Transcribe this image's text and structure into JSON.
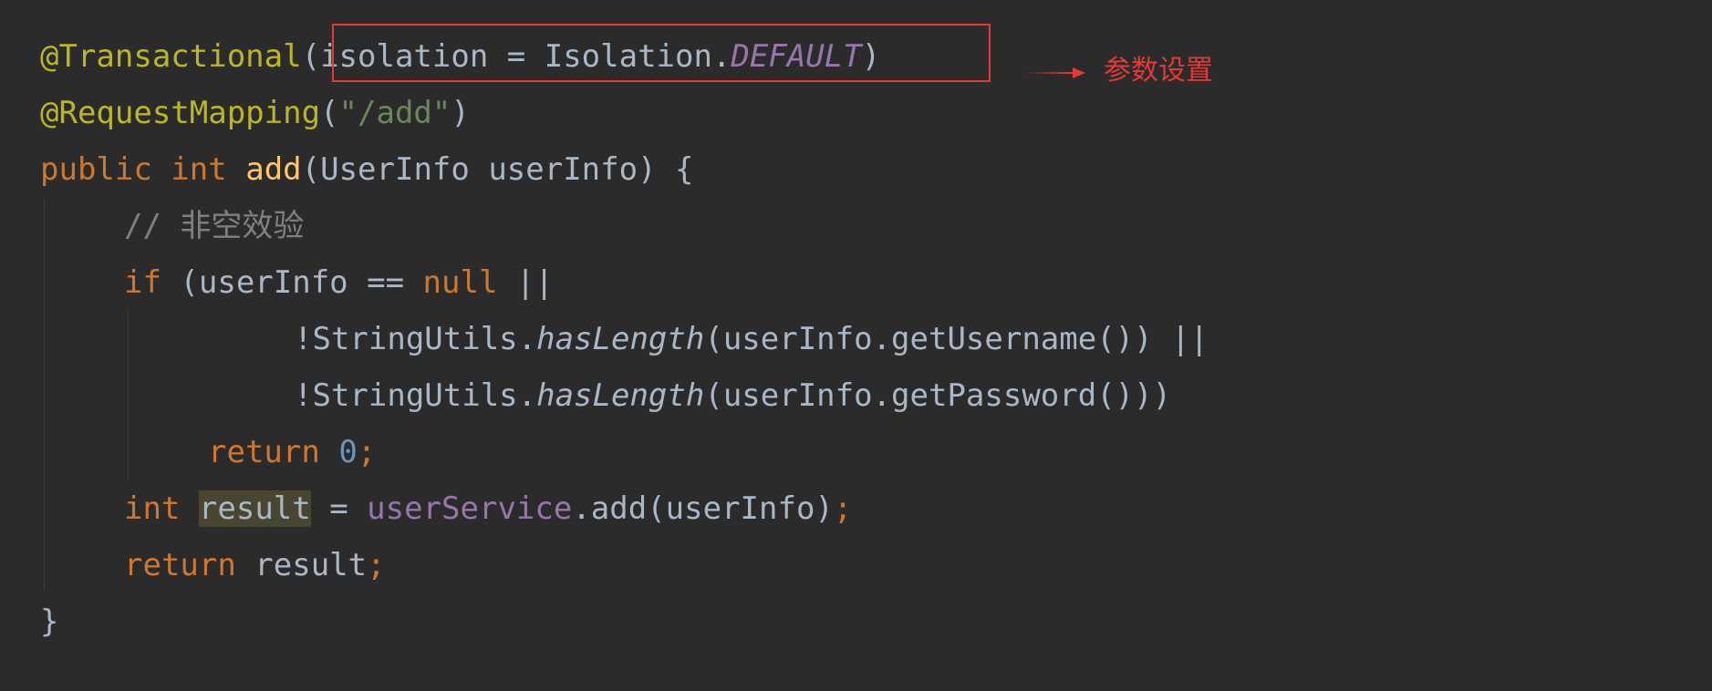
{
  "code": {
    "lines": [
      {
        "tokens": [
          "@Transactional",
          "(",
          "isolation",
          " = ",
          "Isolation.",
          "DEFAULT",
          ")"
        ]
      },
      {
        "tokens": [
          "@RequestMapping",
          "(",
          "\"/add\"",
          ")"
        ]
      },
      {
        "tokens": [
          "public",
          " ",
          "int",
          " ",
          "add",
          "(UserInfo userInfo) {"
        ]
      },
      {
        "tokens": [
          "// 非空效验"
        ]
      },
      {
        "tokens": [
          "if",
          " (userInfo == ",
          "null",
          " ||"
        ]
      },
      {
        "tokens": [
          "!StringUtils.",
          "hasLength",
          "(userInfo.getUsername()) ||"
        ]
      },
      {
        "tokens": [
          "!StringUtils.",
          "hasLength",
          "(userInfo.getPassword()))"
        ]
      },
      {
        "tokens": [
          "return",
          " ",
          "0",
          ";"
        ]
      },
      {
        "tokens": [
          "int",
          " ",
          "result",
          " = ",
          "userService",
          ".add(userInfo)",
          ";"
        ]
      },
      {
        "tokens": [
          "return",
          " result",
          ";"
        ]
      },
      {
        "tokens": [
          "}"
        ]
      }
    ]
  },
  "annotation": {
    "label": "参数设置",
    "color": "#e53935"
  },
  "colors": {
    "background": "#2b2b2b",
    "annotation": "#bbb529",
    "keyword": "#cc7832",
    "function": "#ffc66d",
    "string": "#6a8759",
    "comment": "#808080",
    "number": "#6897bb",
    "constant": "#9876aa",
    "text": "#a9b7c6"
  }
}
